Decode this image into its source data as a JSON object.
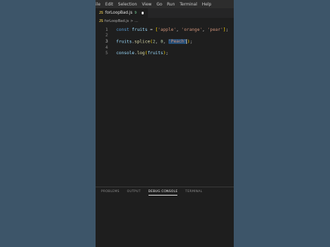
{
  "menubar": {
    "items": [
      "ile",
      "Edit",
      "Selection",
      "View",
      "Go",
      "Run",
      "Terminal",
      "Help"
    ]
  },
  "tab": {
    "icon_text": "JS",
    "filename": "forLoopBad.js",
    "problems_count": "9"
  },
  "breadcrumb": {
    "file_icon": "JS",
    "file": "forLoopBad.js",
    "sep": ">",
    "trail": "..."
  },
  "code": {
    "line_numbers": [
      "1",
      "2",
      "3",
      "4",
      "5"
    ],
    "l1": {
      "kw": "const",
      "var": "fruits",
      "eq": " = ",
      "open": "[",
      "s1": "'apple'",
      "c1": ", ",
      "s2": "'orange'",
      "c2": ", ",
      "s3": "'pear'",
      "close": "]",
      "end": ";"
    },
    "l3": {
      "obj": "fruits",
      "dot": ".",
      "fn": "splice",
      "open": "(",
      "n1": "2",
      "c1": ", ",
      "n2": "0",
      "c2": ", ",
      "sel": "'Peach'",
      "close": ")",
      "end": ";"
    },
    "l5": {
      "obj": "console",
      "dot": ".",
      "fn": "log",
      "open": "(",
      "arg": "fruits",
      "close": ")",
      "end": ";"
    }
  },
  "panel": {
    "tabs": [
      "PROBLEMS",
      "OUTPUT",
      "DEBUG CONSOLE",
      "TERMINAL"
    ],
    "active_tab": "DEBUG CONSOLE"
  },
  "colors": {
    "background": "#3d5569",
    "editor": "#1e1e1e",
    "keyword": "#569cd6",
    "variable": "#9cdcfe",
    "string": "#ce9178",
    "number": "#b5cea8",
    "function": "#dcdcaa",
    "selection": "#264f78"
  }
}
